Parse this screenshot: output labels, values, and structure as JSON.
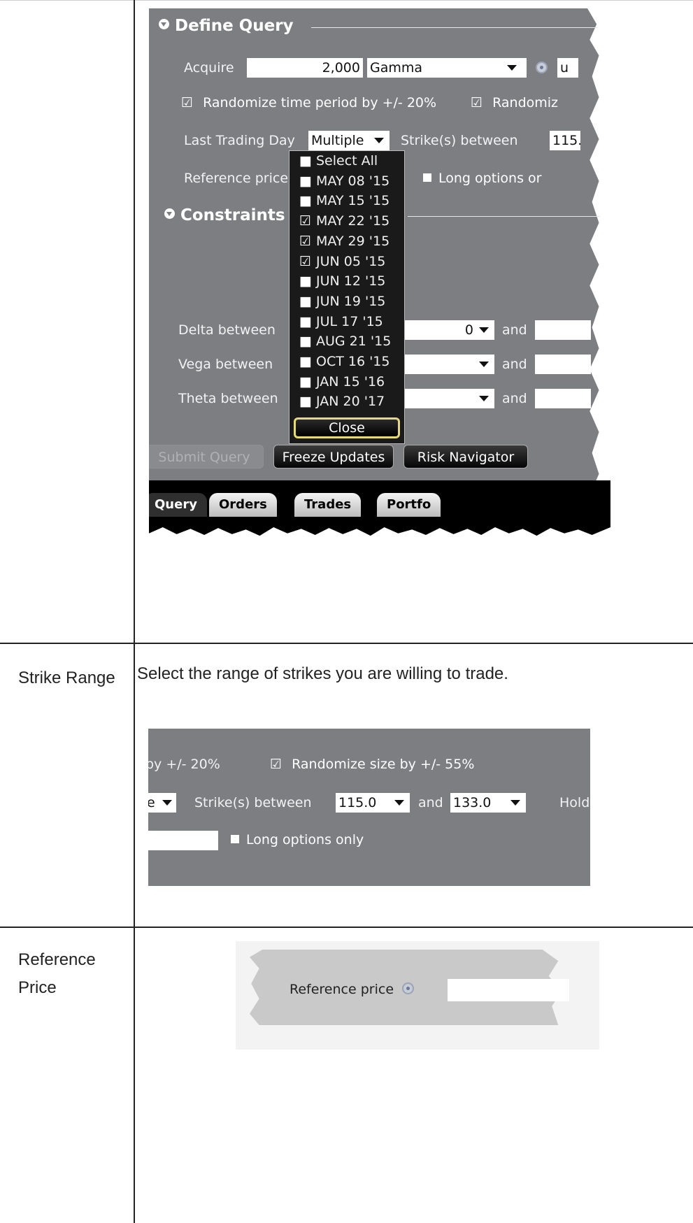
{
  "panel1": {
    "define_query": "Define Query",
    "acquire_label": "Acquire",
    "acquire_value": "2,000",
    "acquire_metric": "Gamma",
    "acquire_cut": "u",
    "randomize_time": "Randomize time period by +/- 20%",
    "randomize_cut": "Randomiz",
    "last_trading_day_label": "Last Trading Day",
    "last_trading_day_value": "Multiple",
    "strikes_between_label": "Strike(s) between",
    "strike_cut": "115.",
    "reference_price_label": "Reference price",
    "long_options": "Long options or",
    "constraints": "Constraints",
    "delta_between": "Delta between",
    "vega_between": "Vega between",
    "theta_between": "Theta between",
    "delta_value": "0",
    "and_label": "and",
    "dropdown": {
      "items": [
        {
          "label": "Select All",
          "checked": false
        },
        {
          "label": "MAY 08 '15",
          "checked": false
        },
        {
          "label": "MAY 15 '15",
          "checked": false
        },
        {
          "label": "MAY 22 '15",
          "checked": true
        },
        {
          "label": "MAY 29 '15",
          "checked": true
        },
        {
          "label": "JUN 05 '15",
          "checked": true
        },
        {
          "label": "JUN 12 '15",
          "checked": false
        },
        {
          "label": "JUN 19 '15",
          "checked": false
        },
        {
          "label": "JUL 17 '15",
          "checked": false
        },
        {
          "label": "AUG 21 '15",
          "checked": false
        },
        {
          "label": "OCT 16 '15",
          "checked": false
        },
        {
          "label": "JAN 15 '16",
          "checked": false
        },
        {
          "label": "JAN 20 '17",
          "checked": false
        }
      ],
      "close_label": "Close"
    },
    "submit_query": "Submit Query",
    "freeze_updates": "Freeze Updates",
    "risk_navigator": "Risk Navigator",
    "tabs": [
      "Query",
      "Orders",
      "Trades",
      "Portfo"
    ]
  },
  "rows": {
    "strike_label": "Strike Range",
    "strike_desc": "Select the range of strikes you are willing to trade.",
    "reference_label": "Reference Price"
  },
  "panel2": {
    "by_text": "by +/- 20%",
    "randomize_size": "Randomize size by +/- 55%",
    "e_text": "e",
    "strikes_between": "Strike(s) between",
    "strike_low": "115.0",
    "and_label": "and",
    "strike_high": "133.0",
    "hold_cut": "Hold",
    "long_options_only": "Long options only"
  },
  "panel3": {
    "reference_price": "Reference price"
  }
}
